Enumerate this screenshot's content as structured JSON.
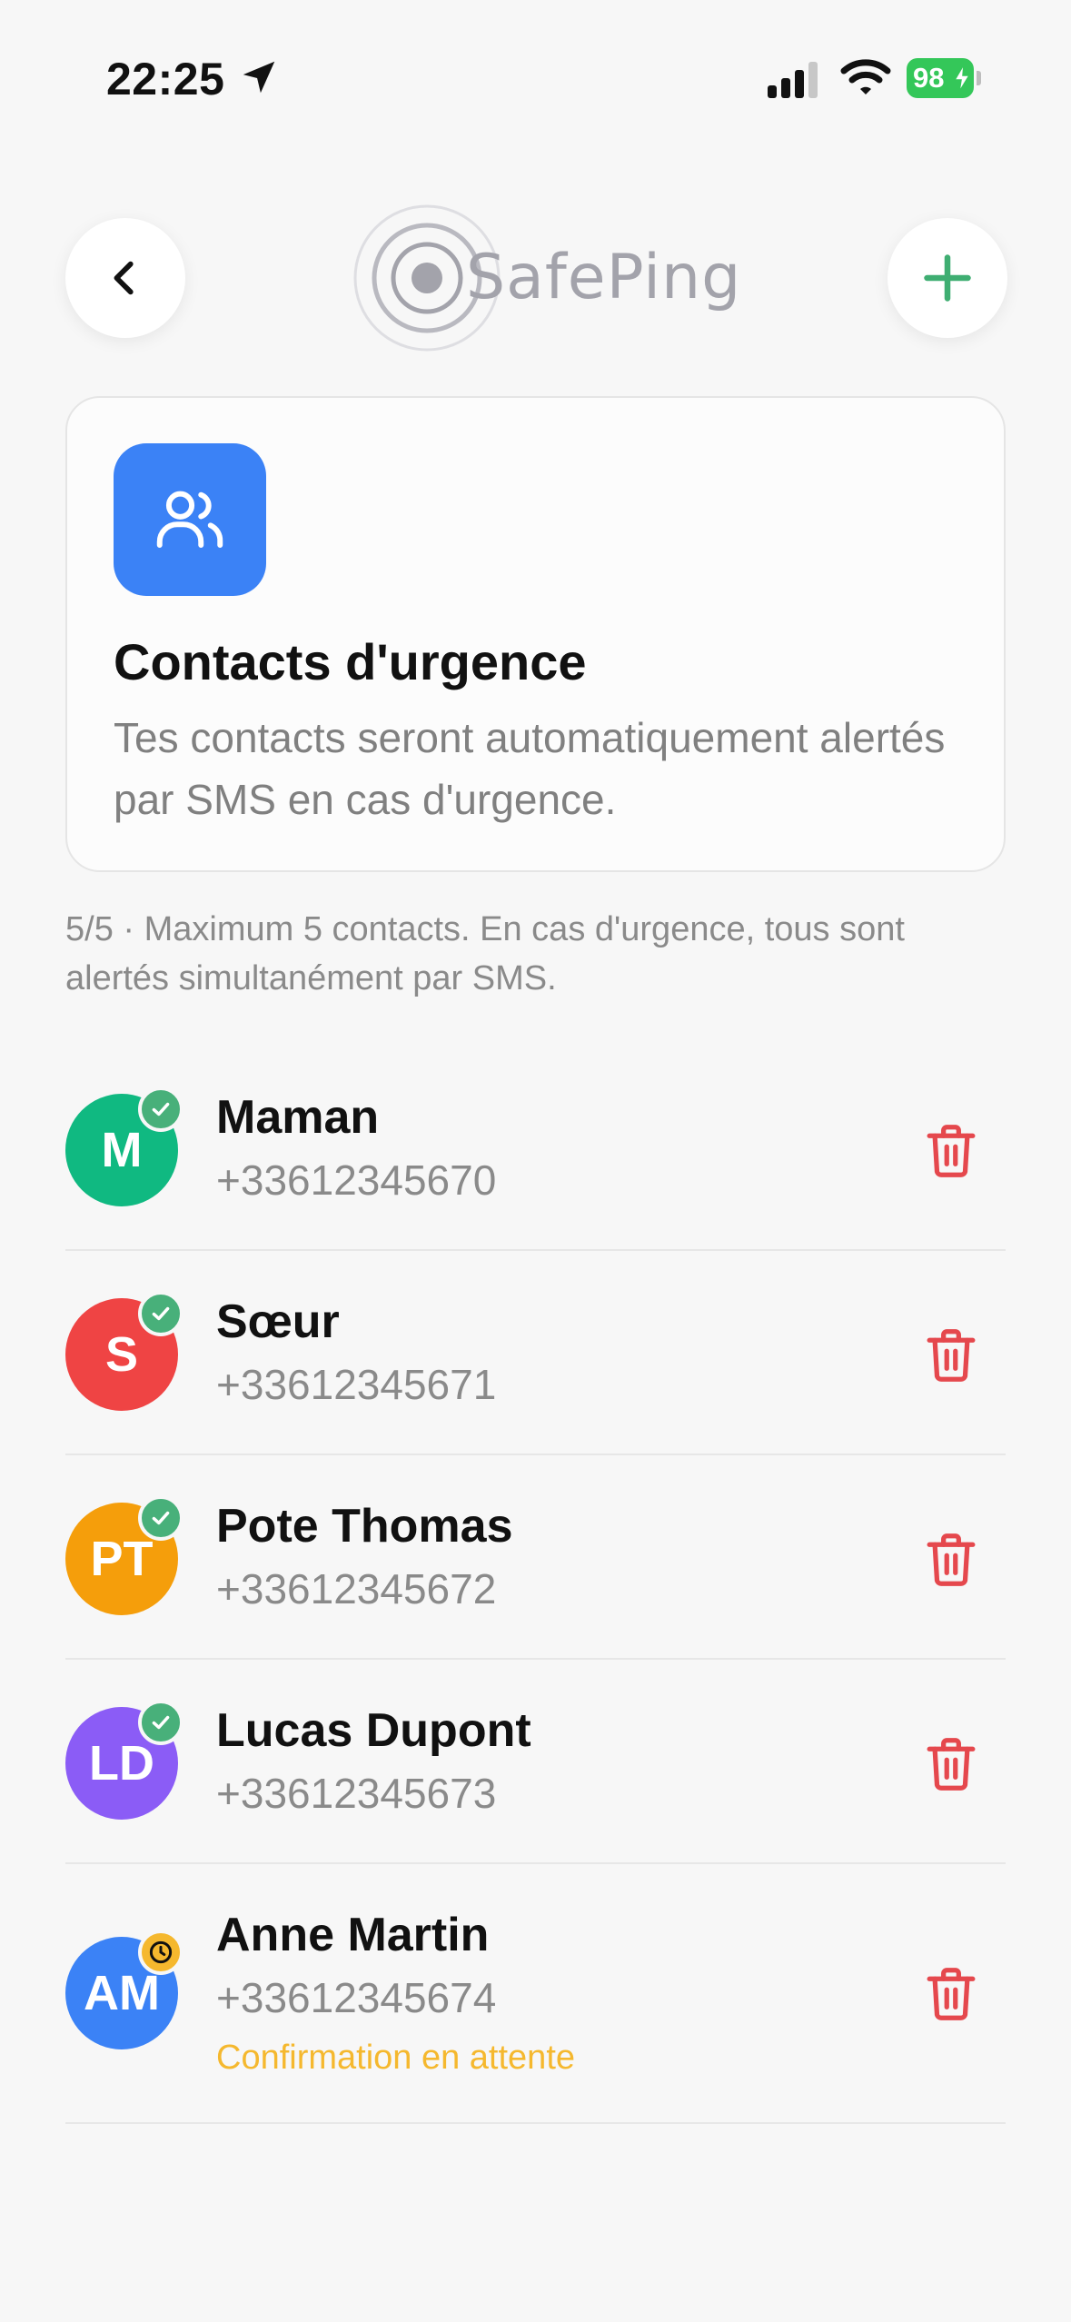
{
  "status_bar": {
    "time": "22:25",
    "battery": "98",
    "icons": [
      "location-arrow-icon",
      "cellular-signal-icon",
      "wifi-icon",
      "battery-charging-icon"
    ]
  },
  "header": {
    "logo_text": "SafePing",
    "back_icon": "chevron-left-icon",
    "add_icon": "plus-icon",
    "colors": {
      "add": "#3fae72",
      "logo": "#a3a3ab"
    }
  },
  "info_card": {
    "icon": "users-icon",
    "title": "Contacts d'urgence",
    "description": "Tes contacts seront automatiquement alertés par SMS en cas d'urgence.",
    "icon_color": "#3b82f6"
  },
  "note": "5/5 · Maximum 5 contacts. En cas d'urgence, tous sont alertés simultanément par SMS.",
  "contacts": [
    {
      "initials": "M",
      "name": "Maman",
      "phone": "+33612345670",
      "avatar_color": "#10b981",
      "status": "confirmed",
      "status_icon": "check-icon"
    },
    {
      "initials": "S",
      "name": "Sœur",
      "phone": "+33612345671",
      "avatar_color": "#ef4444",
      "status": "confirmed",
      "status_icon": "check-icon"
    },
    {
      "initials": "PT",
      "name": "Pote Thomas",
      "phone": "+33612345672",
      "avatar_color": "#f59e0b",
      "status": "confirmed",
      "status_icon": "check-icon"
    },
    {
      "initials": "LD",
      "name": "Lucas Dupont",
      "phone": "+33612345673",
      "avatar_color": "#8b5cf6",
      "status": "confirmed",
      "status_icon": "check-icon"
    },
    {
      "initials": "AM",
      "name": "Anne Martin",
      "phone": "+33612345674",
      "avatar_color": "#3b82f6",
      "status": "pending",
      "status_icon": "clock-icon",
      "status_text": "Confirmation en attente"
    }
  ],
  "colors": {
    "confirmed_badge": "#48b07a",
    "pending_badge": "#f5b82e",
    "delete": "#e5484d"
  },
  "delete_icon": "trash-icon"
}
